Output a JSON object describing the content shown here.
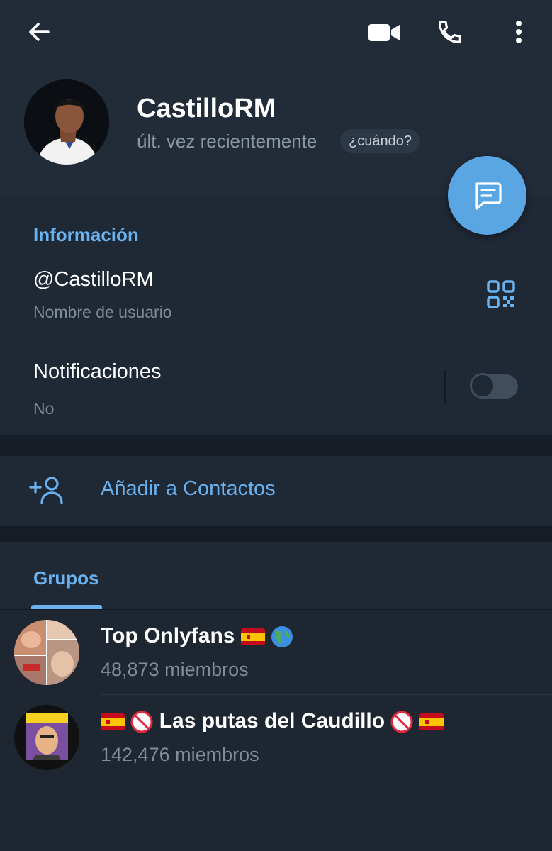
{
  "header": {
    "name": "CastilloRM",
    "status": "últ. vez recientemente",
    "when_chip": "¿cuándo?"
  },
  "toolbar": {
    "back_icon": "arrow-left-icon",
    "video_icon": "video-camera-icon",
    "call_icon": "phone-icon",
    "more_icon": "more-vertical-icon"
  },
  "fab": {
    "icon": "message-icon"
  },
  "info": {
    "section_title": "Información",
    "username": "@CastilloRM",
    "username_label": "Nombre de usuario",
    "notifications_label": "Notificaciones",
    "notifications_value": "No",
    "notifications_enabled": false
  },
  "actions": {
    "add_contact": "Añadir a Contactos"
  },
  "groups": {
    "tab_label": "Grupos",
    "items": [
      {
        "name": "Top Onlyfans",
        "members": "48,873 miembros"
      },
      {
        "name": "Las putas del Caudillo",
        "members": "142,476 miembros"
      }
    ]
  },
  "colors": {
    "accent": "#6ab2ef",
    "fab": "#5aa6e3",
    "background": "#1e2631",
    "header": "#222b38"
  }
}
